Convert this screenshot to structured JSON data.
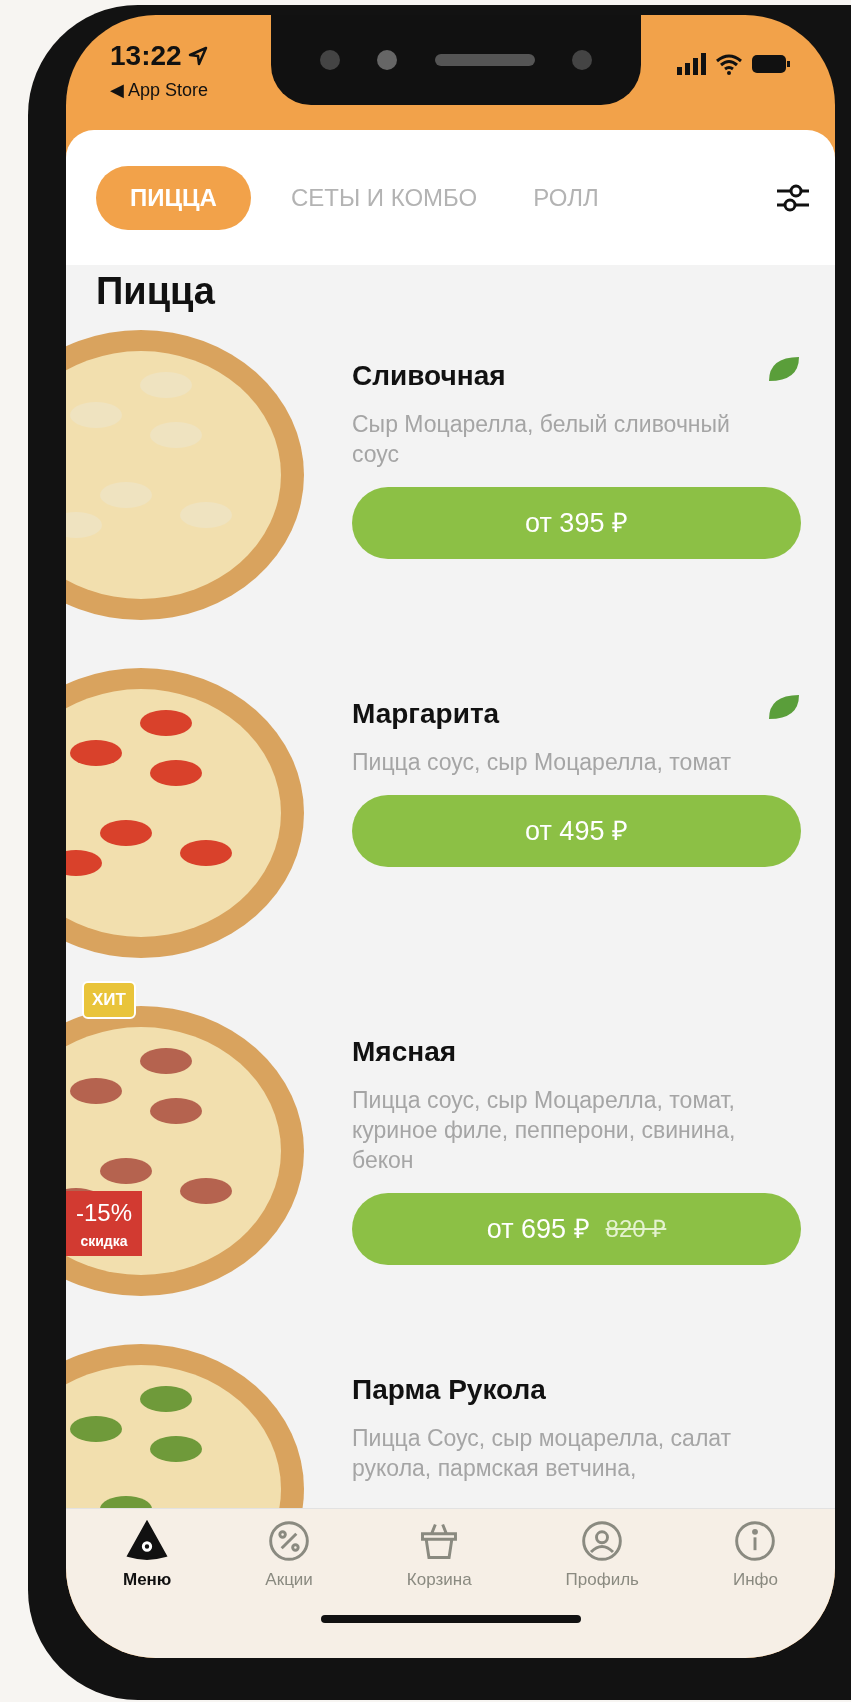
{
  "status_bar": {
    "time": "13:22",
    "back_label": "◀ App Store"
  },
  "tabs": [
    {
      "label": "ПИЦЦА",
      "selected": true
    },
    {
      "label": "СЕТЫ И КОМБО",
      "selected": false
    },
    {
      "label": "РОЛЛ",
      "selected": false
    }
  ],
  "section_title": "Пицца",
  "products": [
    {
      "name": "Сливочная",
      "description": "Сыр Моцарелла, белый сливочный соус",
      "price": "от 395 ₽",
      "vegetarian": true,
      "kind": "cheese"
    },
    {
      "name": "Маргарита",
      "description": "Пицца соус, сыр Моцарелла, томат",
      "price": "от 495 ₽",
      "vegetarian": true,
      "kind": "tomato"
    },
    {
      "name": "Мясная",
      "description": "Пицца соус, сыр Моцарелла, томат, куриное филе, пепперони, свинина, бекон",
      "price": "от 695 ₽",
      "old_price": "820 ₽",
      "vegetarian": false,
      "kind": "meat",
      "hit_badge": "ХИТ",
      "discount": {
        "value": "-15%",
        "label": "скидка"
      }
    },
    {
      "name": "Парма Рукола",
      "description": "Пицца Соус, сыр моцарелла, салат рукола, пармская ветчина,",
      "vegetarian": false,
      "kind": "arugula"
    }
  ],
  "bottom_nav": [
    {
      "label": "Меню",
      "kind": "pizza",
      "selected": true
    },
    {
      "label": "Акции",
      "kind": "percent",
      "selected": false
    },
    {
      "label": "Корзина",
      "kind": "basket",
      "selected": false
    },
    {
      "label": "Профиль",
      "kind": "profile",
      "selected": false
    },
    {
      "label": "Инфо",
      "kind": "info",
      "selected": false
    }
  ]
}
